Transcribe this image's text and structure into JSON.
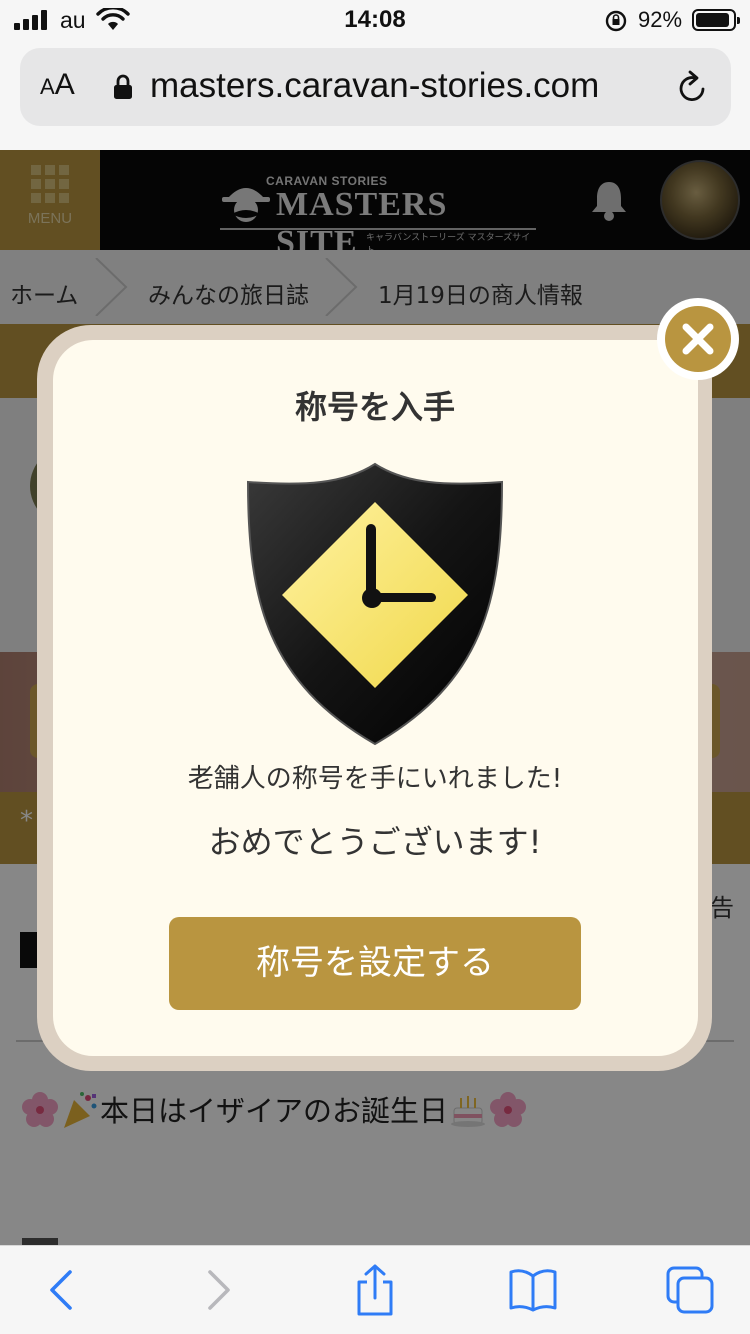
{
  "status_bar": {
    "carrier": "au",
    "time": "14:08",
    "battery_percent": "92%"
  },
  "browser": {
    "text_size_small": "A",
    "text_size_large": "A",
    "url": "masters.caravan-stories.com"
  },
  "site_header": {
    "menu_label": "MENU",
    "logo_top": "CARAVAN STORIES",
    "logo_main": "MASTERS SITE",
    "logo_kana": "キャラバンストーリーズ マスターズサイト"
  },
  "breadcrumb": [
    "ホーム",
    "みんなの旅日誌",
    "1月19日の商人情報"
  ],
  "page": {
    "notice_mark": "*",
    "report_label": "告",
    "article_title": "本日はイザイアのお誕生日"
  },
  "modal": {
    "title": "称号を入手",
    "message": "老舗人の称号を手にいれました!",
    "congrats": "おめでとうございます!",
    "button_label": "称号を設定する"
  },
  "colors": {
    "accent_gold": "#b99540",
    "modal_bg": "#fffbee",
    "ios_blue": "#2f7cf6"
  },
  "icons": [
    "signal-icon",
    "wifi-icon",
    "orientation-lock-icon",
    "battery-icon",
    "lock-icon",
    "reload-icon",
    "menu-grid-icon",
    "bell-icon",
    "close-icon",
    "title-badge-icon",
    "back-icon",
    "forward-icon",
    "share-icon",
    "bookmarks-icon",
    "tabs-icon"
  ]
}
